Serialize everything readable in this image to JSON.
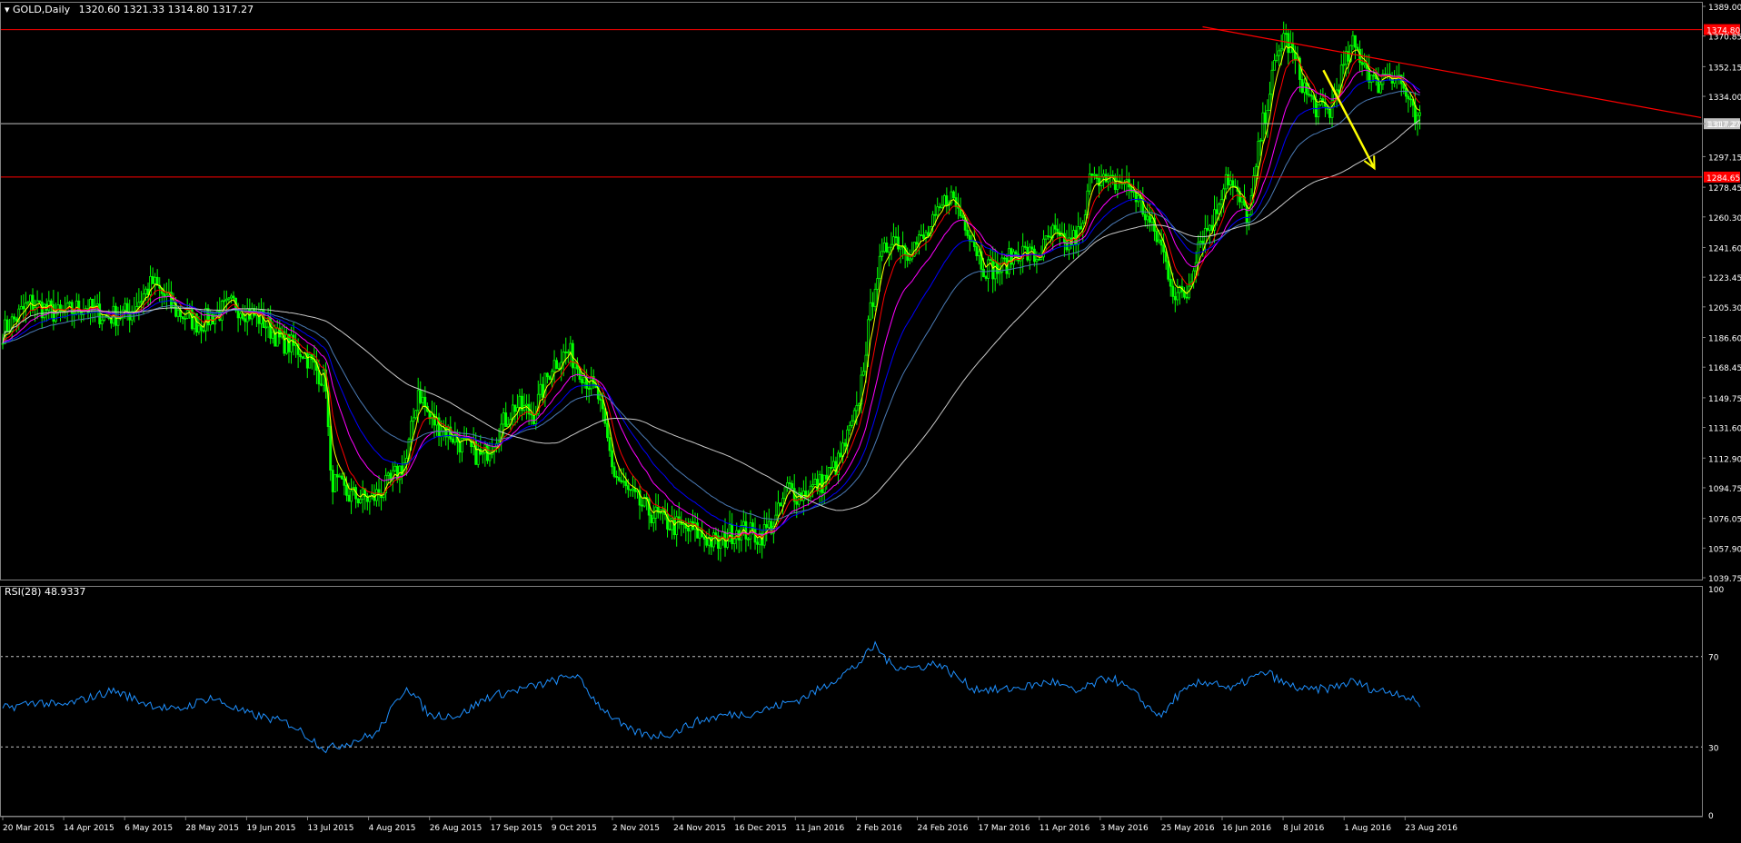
{
  "header": {
    "symbol_label": "GOLD,Daily",
    "ohlc": "1320.60 1321.33 1314.80 1317.27"
  },
  "rsi_header": {
    "label": "RSI(28) 48.9337"
  },
  "colors": {
    "background": "#000000",
    "candle": "#00ff00",
    "ema_fast": "#ffff00",
    "ema_2": "#ff0000",
    "ema_3": "#ff00ff",
    "ema_4": "#0000ff",
    "ema_5": "#4a7ab5",
    "sma_long": "#c8c8c8",
    "level_line": "#ff0000",
    "current_line": "#c0c0c0",
    "trend_arrow": "#ffff00",
    "rsi_line": "#1e90ff",
    "axis_text": "#ffffff"
  },
  "chart_data": [
    {
      "type": "candlestick",
      "title": "GOLD,Daily",
      "x_ticks": [
        "20 Mar 2015",
        "14 Apr 2015",
        "6 May 2015",
        "28 May 2015",
        "19 Jun 2015",
        "13 Jul 2015",
        "4 Aug 2015",
        "26 Aug 2015",
        "17 Sep 2015",
        "9 Oct 2015",
        "2 Nov 2015",
        "24 Nov 2015",
        "16 Dec 2015",
        "11 Jan 2016",
        "2 Feb 2016",
        "24 Feb 2016",
        "17 Mar 2016",
        "11 Apr 2016",
        "3 May 2016",
        "25 May 2016",
        "16 Jun 2016",
        "8 Jul 2016",
        "1 Aug 2016",
        "23 Aug 2016"
      ],
      "y_ticks": [
        "1389.00",
        "1370.85",
        "1352.15",
        "1334.00",
        "1317.27",
        "1297.15",
        "1278.45",
        "1260.30",
        "1241.60",
        "1223.45",
        "1205.30",
        "1186.60",
        "1168.45",
        "1149.75",
        "1131.60",
        "1112.90",
        "1094.75",
        "1076.05",
        "1057.90",
        "1039.75"
      ],
      "ylim": [
        1039.75,
        1389.0
      ],
      "price_path": [
        [
          0,
          1190
        ],
        [
          12,
          1208
        ],
        [
          25,
          1200
        ],
        [
          35,
          1206
        ],
        [
          45,
          1199
        ],
        [
          55,
          1202
        ],
        [
          65,
          1220
        ],
        [
          75,
          1203
        ],
        [
          85,
          1195
        ],
        [
          100,
          1207
        ],
        [
          112,
          1198
        ],
        [
          120,
          1185
        ],
        [
          130,
          1178
        ],
        [
          140,
          1159
        ],
        [
          142,
          1100
        ],
        [
          150,
          1090
        ],
        [
          160,
          1088
        ],
        [
          168,
          1098
        ],
        [
          175,
          1112
        ],
        [
          180,
          1155
        ],
        [
          185,
          1137
        ],
        [
          192,
          1130
        ],
        [
          200,
          1120
        ],
        [
          208,
          1113
        ],
        [
          215,
          1130
        ],
        [
          222,
          1145
        ],
        [
          230,
          1140
        ],
        [
          238,
          1170
        ],
        [
          245,
          1178
        ],
        [
          250,
          1168
        ],
        [
          258,
          1150
        ],
        [
          265,
          1103
        ],
        [
          272,
          1090
        ],
        [
          280,
          1080
        ],
        [
          290,
          1072
        ],
        [
          300,
          1068
        ],
        [
          310,
          1060
        ],
        [
          318,
          1070
        ],
        [
          328,
          1065
        ],
        [
          335,
          1075
        ],
        [
          340,
          1095
        ],
        [
          345,
          1090
        ],
        [
          355,
          1098
        ],
        [
          362,
          1110
        ],
        [
          370,
          1140
        ],
        [
          378,
          1222
        ],
        [
          385,
          1250
        ],
        [
          392,
          1240
        ],
        [
          400,
          1248
        ],
        [
          405,
          1260
        ],
        [
          410,
          1275
        ],
        [
          418,
          1255
        ],
        [
          425,
          1230
        ],
        [
          432,
          1228
        ],
        [
          440,
          1240
        ],
        [
          448,
          1235
        ],
        [
          455,
          1250
        ],
        [
          460,
          1242
        ],
        [
          468,
          1252
        ],
        [
          472,
          1292
        ],
        [
          478,
          1280
        ],
        [
          485,
          1282
        ],
        [
          490,
          1276
        ],
        [
          495,
          1262
        ],
        [
          502,
          1242
        ],
        [
          508,
          1212
        ],
        [
          513,
          1213
        ],
        [
          518,
          1245
        ],
        [
          525,
          1260
        ],
        [
          530,
          1287
        ],
        [
          535,
          1272
        ],
        [
          540,
          1260
        ],
        [
          545,
          1310
        ],
        [
          550,
          1345
        ],
        [
          555,
          1372
        ],
        [
          560,
          1355
        ],
        [
          565,
          1335
        ],
        [
          570,
          1326
        ],
        [
          575,
          1325
        ],
        [
          580,
          1348
        ],
        [
          585,
          1365
        ],
        [
          590,
          1355
        ],
        [
          595,
          1340
        ],
        [
          600,
          1350
        ],
        [
          605,
          1345
        ],
        [
          608,
          1335
        ],
        [
          612,
          1318
        ],
        [
          614,
          1317.27
        ]
      ],
      "overlays": [
        {
          "name": "yellow MA",
          "period": 5,
          "color": "#ffff00"
        },
        {
          "name": "red MA",
          "period": 10,
          "color": "#ff0000"
        },
        {
          "name": "magenta MA",
          "period": 21,
          "color": "#ff00ff"
        },
        {
          "name": "blue MA",
          "period": 34,
          "color": "#0000ff"
        },
        {
          "name": "steel MA",
          "period": 55,
          "color": "#4a7ab5"
        },
        {
          "name": "grey MA",
          "period": 100,
          "color": "#c8c8c8"
        }
      ],
      "horizontal_levels": [
        {
          "price": 1374.8,
          "label": "1374.80",
          "color": "#ff0000"
        },
        {
          "price": 1284.65,
          "label": "1284.65",
          "color": "#ff0000"
        },
        {
          "price": 1317.27,
          "label": "1317.27",
          "color": "#c0c0c0"
        }
      ],
      "trendline": {
        "from": [
          0.707,
          1376.5
        ],
        "to": [
          1.0,
          1321.0
        ],
        "color": "#ff0000"
      },
      "arrow": {
        "from": [
          0.778,
          1350.0
        ],
        "to": [
          0.808,
          1290.0
        ],
        "color": "#ffff00"
      }
    },
    {
      "type": "line",
      "title": "RSI(28) 48.9337",
      "y_ticks": [
        "100",
        "70",
        "30",
        "0"
      ],
      "ylim": [
        0,
        100
      ],
      "levels": [
        70,
        30
      ],
      "values": [
        [
          0,
          47
        ],
        [
          15,
          50
        ],
        [
          25,
          48
        ],
        [
          35,
          51
        ],
        [
          48,
          55
        ],
        [
          60,
          50
        ],
        [
          75,
          46
        ],
        [
          90,
          52
        ],
        [
          105,
          45
        ],
        [
          118,
          42
        ],
        [
          125,
          40
        ],
        [
          140,
          29
        ],
        [
          150,
          32
        ],
        [
          162,
          36
        ],
        [
          175,
          57
        ],
        [
          185,
          44
        ],
        [
          198,
          44
        ],
        [
          210,
          52
        ],
        [
          222,
          55
        ],
        [
          235,
          58
        ],
        [
          248,
          62
        ],
        [
          258,
          49
        ],
        [
          270,
          38
        ],
        [
          280,
          35
        ],
        [
          290,
          36
        ],
        [
          300,
          41
        ],
        [
          312,
          44
        ],
        [
          325,
          45
        ],
        [
          335,
          48
        ],
        [
          345,
          51
        ],
        [
          355,
          56
        ],
        [
          362,
          61
        ],
        [
          370,
          66
        ],
        [
          378,
          75
        ],
        [
          385,
          66
        ],
        [
          395,
          65
        ],
        [
          405,
          67
        ],
        [
          412,
          62
        ],
        [
          420,
          56
        ],
        [
          432,
          55
        ],
        [
          445,
          57
        ],
        [
          455,
          59
        ],
        [
          465,
          54
        ],
        [
          475,
          59
        ],
        [
          480,
          61
        ],
        [
          490,
          54
        ],
        [
          498,
          46
        ],
        [
          503,
          44
        ],
        [
          508,
          52
        ],
        [
          518,
          58
        ],
        [
          525,
          59
        ],
        [
          532,
          55
        ],
        [
          540,
          60
        ],
        [
          548,
          63
        ],
        [
          555,
          58
        ],
        [
          565,
          55
        ],
        [
          575,
          56
        ],
        [
          585,
          59
        ],
        [
          595,
          55
        ],
        [
          605,
          54
        ],
        [
          614,
          48.9
        ]
      ]
    }
  ]
}
